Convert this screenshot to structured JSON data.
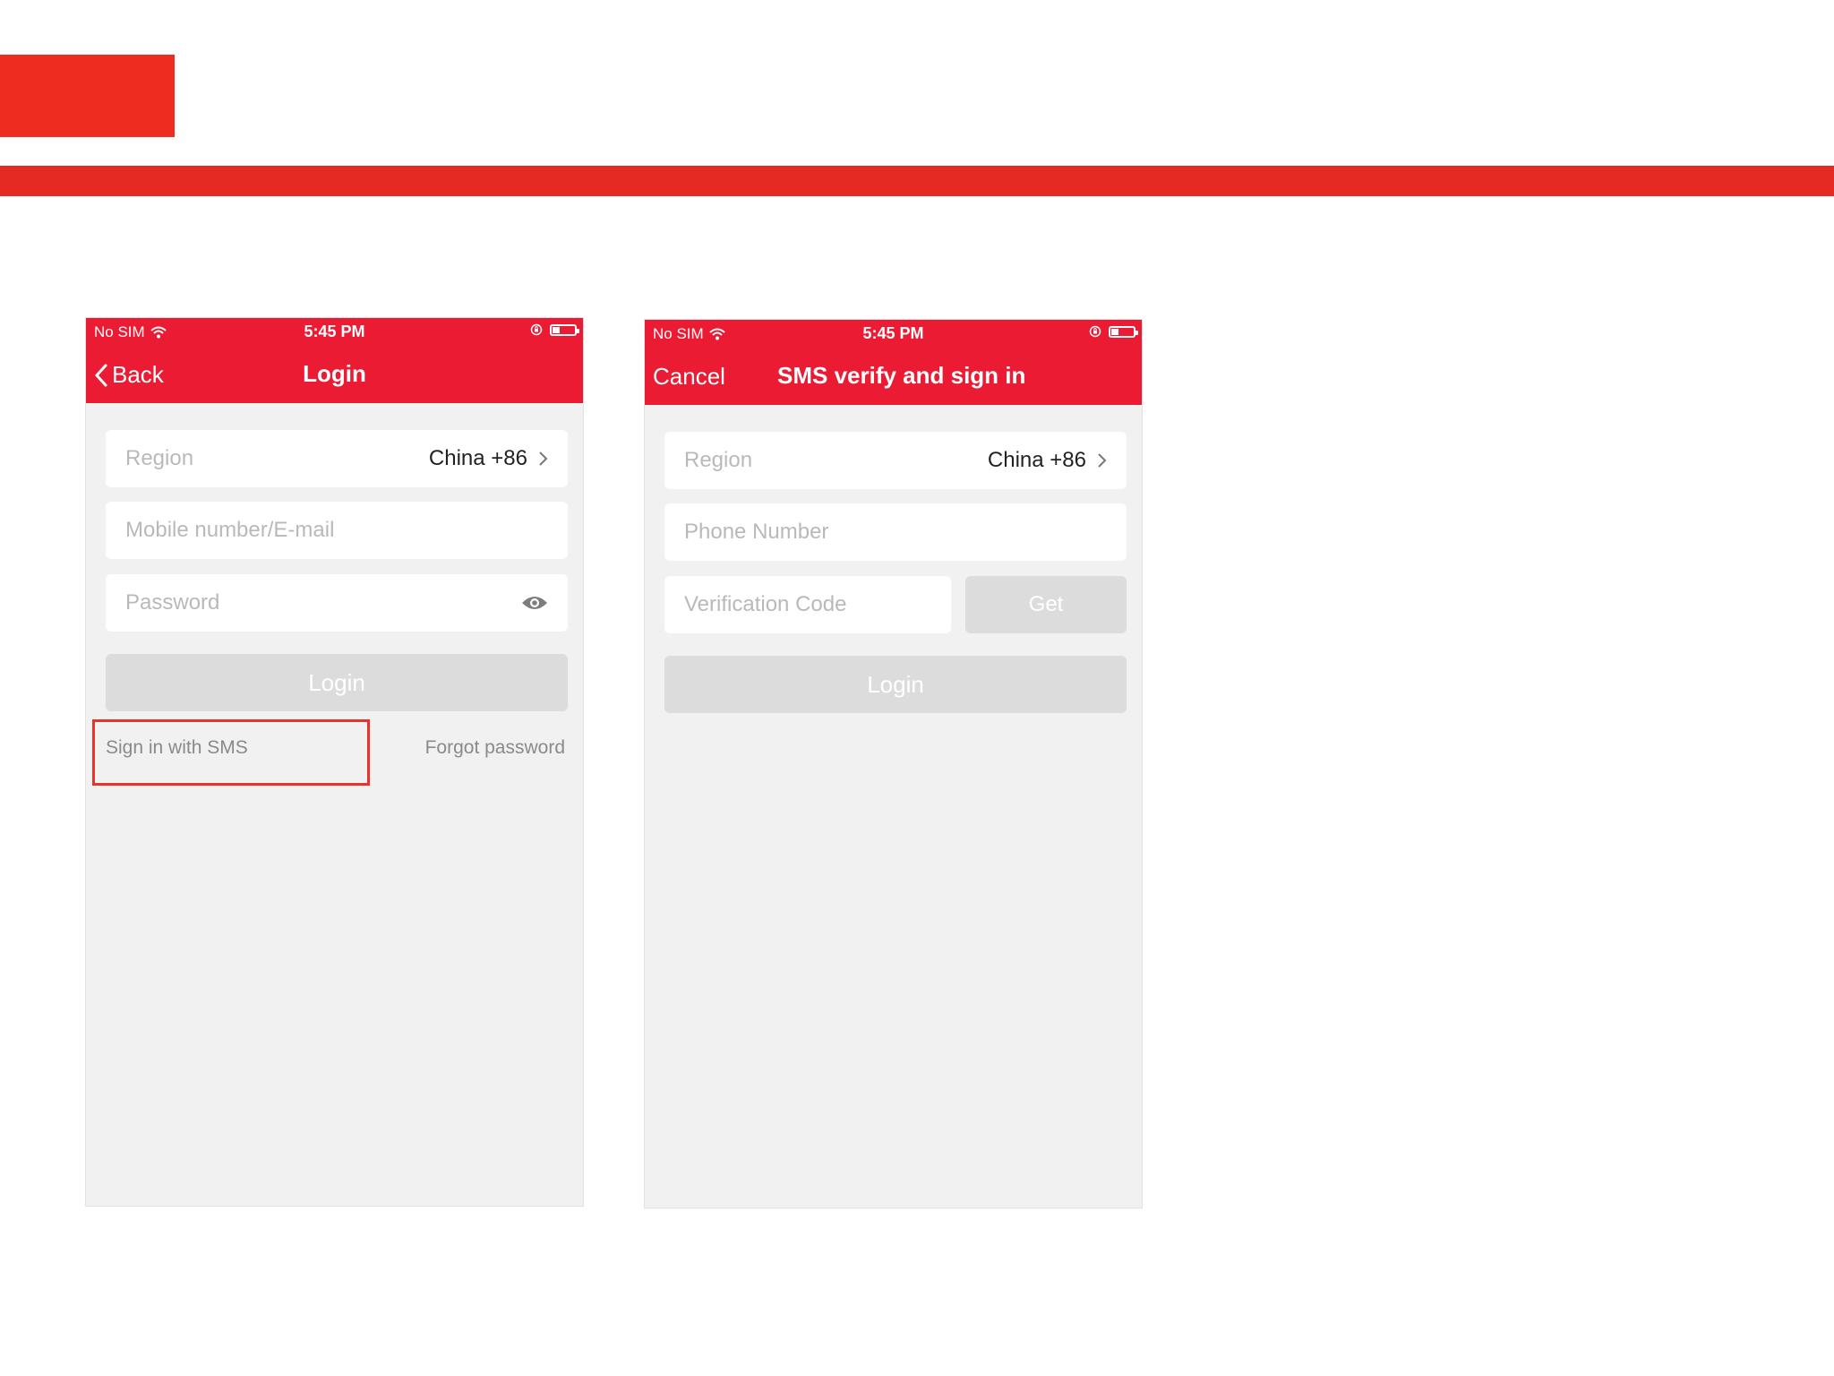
{
  "colors": {
    "accent": "#ec1b34",
    "slide_red": "#ee2d20",
    "highlight": "#e8332a",
    "disabled_button": "#dcdcdc"
  },
  "login_screen": {
    "status": {
      "carrier": "No SIM",
      "time": "5:45 PM"
    },
    "nav": {
      "back_label": "Back",
      "title": "Login"
    },
    "region": {
      "label": "Region",
      "value": "China +86"
    },
    "account_placeholder": "Mobile number/E-mail",
    "password_placeholder": "Password",
    "login_button": "Login",
    "sms_link": "Sign in with SMS",
    "forgot_link": "Forgot password"
  },
  "sms_screen": {
    "status": {
      "carrier": "No SIM",
      "time": "5:45 PM"
    },
    "nav": {
      "cancel_label": "Cancel",
      "title": "SMS verify and sign in"
    },
    "region": {
      "label": "Region",
      "value": "China +86"
    },
    "phone_placeholder": "Phone Number",
    "code_placeholder": "Verification Code",
    "get_button": "Get",
    "login_button": "Login"
  }
}
